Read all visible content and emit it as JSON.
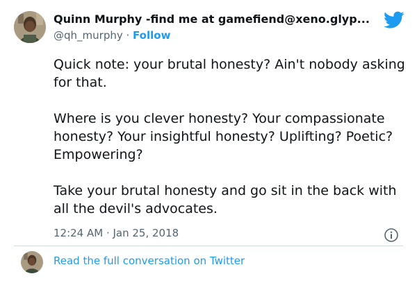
{
  "user": {
    "display_name": "Quinn Murphy -find me at gamefiend@xeno.glyp...",
    "handle": "@qh_murphy",
    "separator": " · ",
    "follow_label": "Follow"
  },
  "tweet": {
    "paragraphs": [
      "Quick note: your brutal honesty? Ain't nobody asking for that.",
      "Where is you clever honesty? Your compassionate honesty? Your insightful honesty? Uplifting? Poetic? Empowering?",
      "Take your brutal honesty and go sit in the back with all the devil's advocates."
    ],
    "timestamp": "12:24 AM · Jan 25, 2018"
  },
  "footer": {
    "read_more_label": "Read the full conversation on Twitter"
  },
  "icons": {
    "brand": "twitter-bird-icon",
    "info": "info-icon"
  },
  "colors": {
    "accent": "#1d9bf0",
    "text": "#0f1419",
    "muted": "#536471"
  }
}
